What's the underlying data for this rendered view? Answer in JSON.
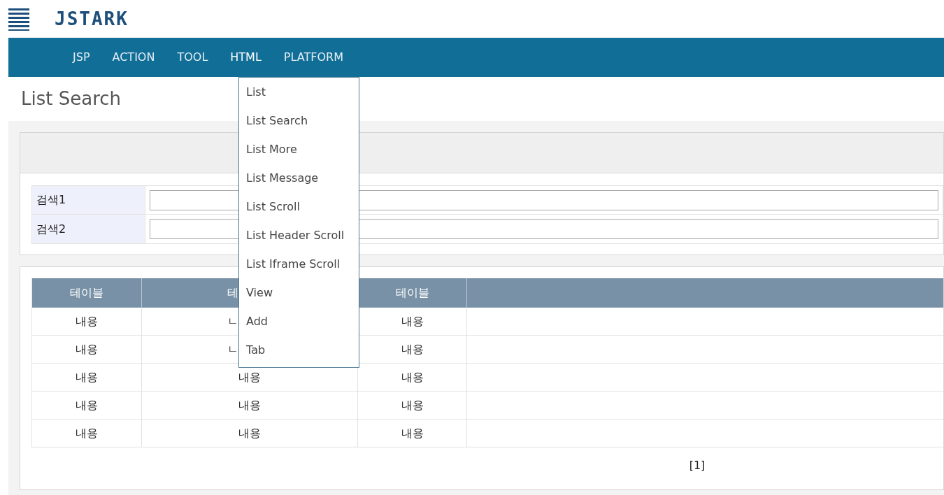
{
  "logo": "JSTARK",
  "nav": [
    {
      "label": "JSP",
      "selected": false
    },
    {
      "label": "ACTION",
      "selected": false
    },
    {
      "label": "TOOL",
      "selected": false
    },
    {
      "label": "HTML",
      "selected": true
    },
    {
      "label": "PLATFORM",
      "selected": false
    }
  ],
  "menu": [
    "List",
    "List Search",
    "List More",
    "List Message",
    "List Scroll",
    "List Header Scroll",
    "List Iframe Scroll",
    "View",
    "Add",
    "Tab"
  ],
  "page_title": "List Search",
  "search_fields": [
    {
      "label": "검색1"
    },
    {
      "label": "검색2"
    }
  ],
  "table": {
    "columns": [
      {
        "text": "테이블",
        "covered": false
      },
      {
        "text": "테",
        "covered": true
      },
      {
        "text": "테이블",
        "covered": false
      }
    ],
    "rows": [
      [
        "내용",
        {
          "text": "ㄴ",
          "covered": true
        },
        "내용"
      ],
      [
        "내용",
        {
          "text": "ㄴ",
          "covered": true
        },
        "내용"
      ],
      [
        "내용",
        "내용",
        "내용"
      ],
      [
        "내용",
        "내용",
        "내용"
      ],
      [
        "내용",
        "내용",
        "내용"
      ]
    ]
  },
  "pagination": "[1]"
}
